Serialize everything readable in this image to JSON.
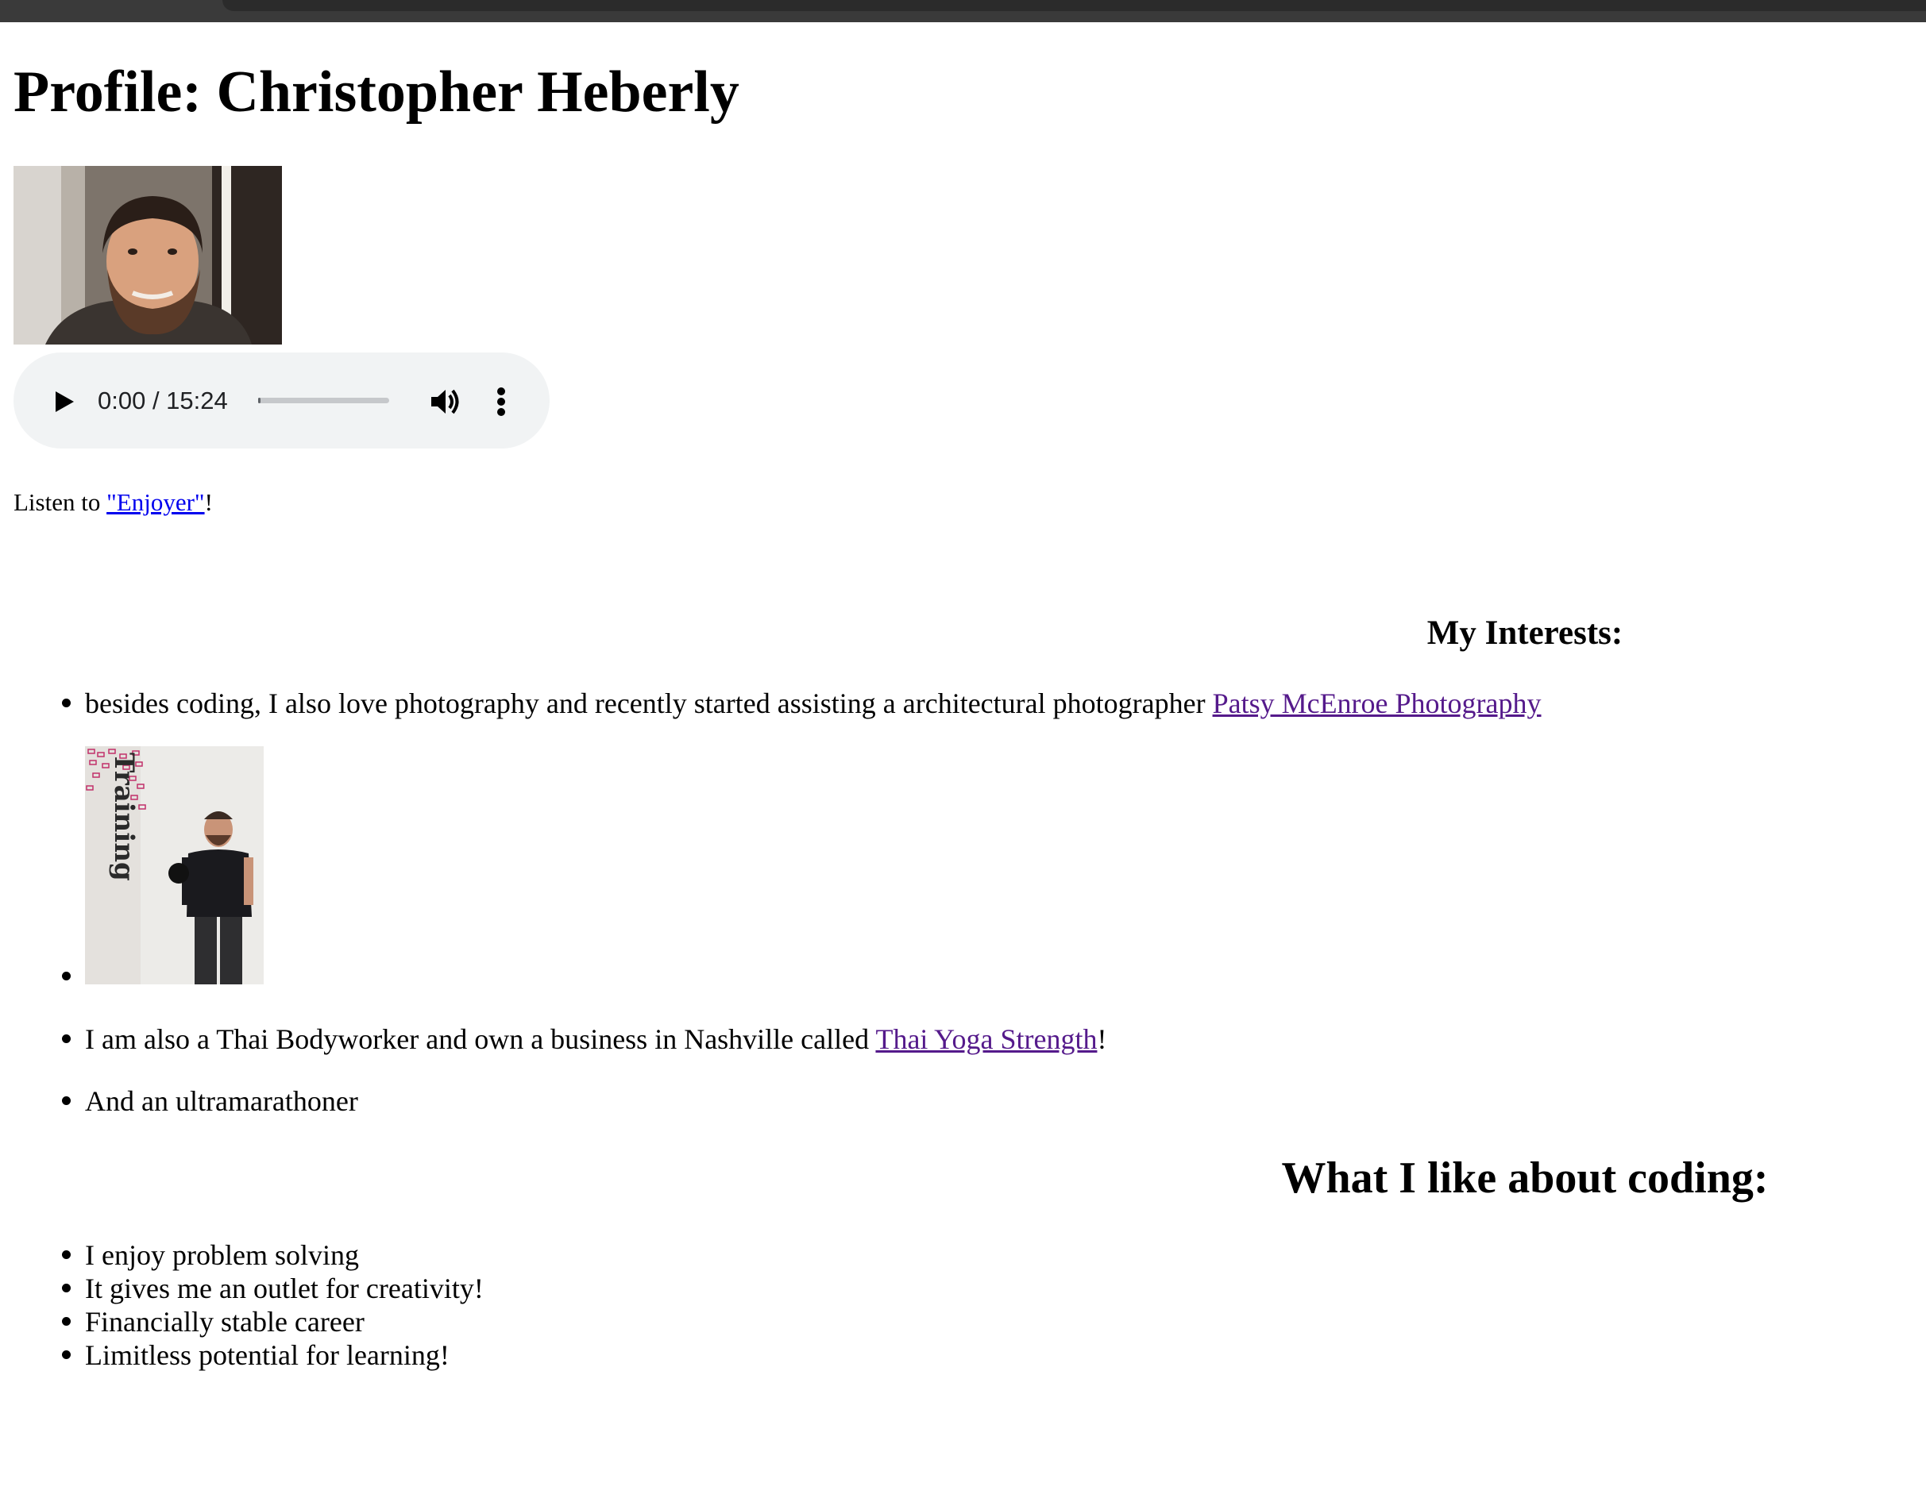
{
  "page": {
    "title": "Profile: Christopher Heberly"
  },
  "audio": {
    "time_display": "0:00 / 15:24",
    "progress": 0,
    "icons": {
      "play": "play-icon",
      "volume": "volume-icon",
      "more": "more-vert-icon"
    }
  },
  "listen": {
    "prefix": "Listen to ",
    "link_text": "\"Enjoyer\"",
    "suffix": "!"
  },
  "interests": {
    "heading": "My Interests:",
    "item1_text": "besides coding, I also love photography and recently started assisting a architectural photographer ",
    "item1_link": "Patsy McEnroe Photography",
    "photo_sign_text": "Training",
    "item3_text": "I am also a Thai Bodyworker and own a business in Nashville called ",
    "item3_link": "Thai Yoga Strength",
    "item3_suffix": "!",
    "item4_text": "And an ultramarathoner"
  },
  "coding": {
    "heading": "What I like about coding:",
    "items": [
      "I enjoy problem solving",
      "It gives me an outlet for creativity!",
      "Financially stable career",
      "Limitless potential for learning!"
    ]
  },
  "colors": {
    "link": "#0000ee",
    "visited_link": "#551a8b",
    "audio_bg": "#f1f3f4",
    "browser_bar": "#3a3a3a"
  }
}
